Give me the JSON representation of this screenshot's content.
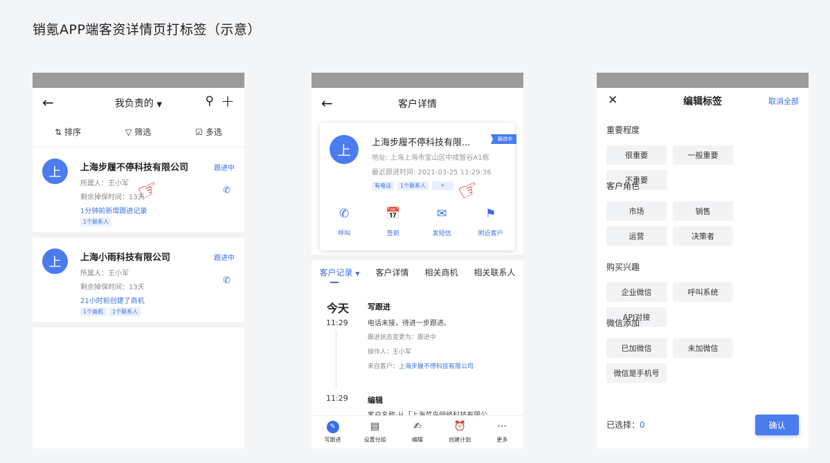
{
  "page_title": "销氪APP端客资详情页打标签（示意）",
  "colors": {
    "accent": "#3a6ee8",
    "avatar": "#4a7cf0",
    "statusbar": "#9b9b9b",
    "pointer": "#e02020"
  },
  "list_screen": {
    "title": "我负责的",
    "toolbar": {
      "sort": "排序",
      "filter": "筛选",
      "multi": "多选"
    },
    "cards": [
      {
        "avatar": "上",
        "name": "上海步履不停科技有限公司",
        "status": "跟进中",
        "owner": "所属人：王小军",
        "remain": "剩余掉保时间：13天",
        "activity": "1分钟前新增跟进记录",
        "tags": [
          "1个联系人"
        ]
      },
      {
        "avatar": "上",
        "name": "上海小雨科技有限公司",
        "status": "跟进中",
        "owner": "所属人：王小军",
        "remain": "剩余掉保时间：13天",
        "activity": "21小时前创建了商机",
        "tags": [
          "1个商机",
          "1个联系人"
        ]
      }
    ]
  },
  "detail_screen": {
    "title": "客户详情",
    "card": {
      "avatar": "上",
      "name": "上海步履不停科技有限...",
      "badge": "跟进中",
      "address": "地址: 上海上海市宝山区中成智谷A1栋",
      "last_follow": "最近跟进时间: 2021-03-25 11:29:36",
      "tags": [
        "有电话",
        "1个联系人"
      ],
      "add_tag": "+"
    },
    "actions": [
      {
        "icon": "phone-icon",
        "label": "呼叫"
      },
      {
        "icon": "calendar-check-icon",
        "label": "签到"
      },
      {
        "icon": "mail-icon",
        "label": "发短信"
      },
      {
        "icon": "location-icon",
        "label": "附近客户"
      }
    ],
    "tabs": [
      "客户记录",
      "客户详情",
      "相关商机",
      "相关联系人"
    ],
    "timeline": {
      "day": "今天",
      "entries": [
        {
          "time": "11:29",
          "type": "写跟进",
          "text": "电话未接，待进一步跟进。",
          "meta1": "跟进状态变更为：跟进中",
          "meta2": "操作人：王小军",
          "meta3_label": "来自客户：",
          "meta3_link": "上海步履不停科技有限公司"
        },
        {
          "time": "11:29",
          "type": "编辑",
          "text": "客户名称:从「上海菜鸟网络科技有限公"
        }
      ]
    },
    "bottom_bar": [
      {
        "icon": "pen-icon",
        "label": "写跟进"
      },
      {
        "icon": "group-icon",
        "label": "设置分组"
      },
      {
        "icon": "edit-icon",
        "label": "编辑"
      },
      {
        "icon": "alarm-icon",
        "label": "创建计划"
      },
      {
        "icon": "more-icon",
        "label": "更多"
      }
    ]
  },
  "tag_screen": {
    "title": "编辑标签",
    "cancel_all": "取消全部",
    "sections": [
      {
        "title": "重要程度",
        "options": [
          "很重要",
          "一般重要",
          "不重要"
        ]
      },
      {
        "title": "客户角色",
        "options": [
          "市场",
          "销售",
          "运营",
          "决策者"
        ]
      },
      {
        "title": "购买兴趣",
        "options": [
          "企业微信",
          "呼叫系统",
          "API对接"
        ]
      },
      {
        "title": "微信添加",
        "options": [
          "已加微信",
          "未加微信",
          "微信是手机号"
        ]
      }
    ],
    "selected_label": "已选择：",
    "selected_count": "0",
    "confirm": "确认"
  }
}
